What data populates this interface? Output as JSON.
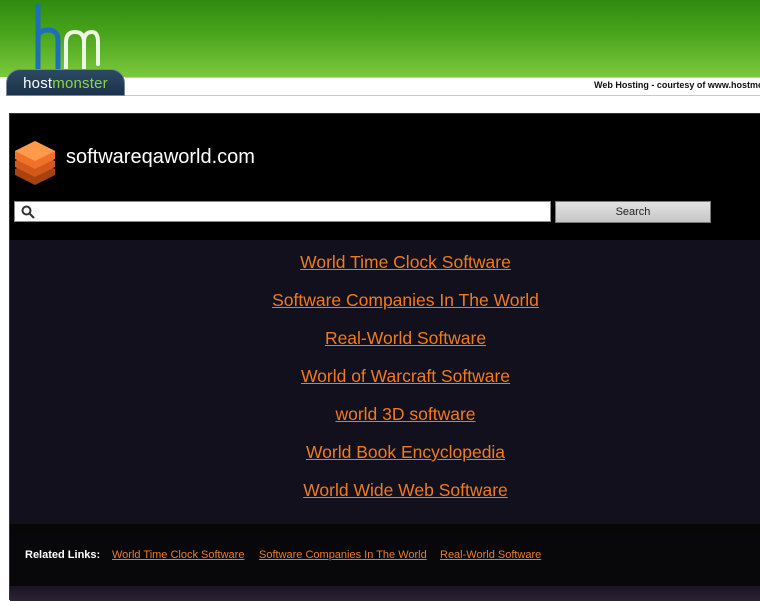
{
  "banner": {
    "logo_host": "host",
    "logo_monster": "monster",
    "credit_text": "Web Hosting - courtesy of www.hostmonster.com"
  },
  "site": {
    "title": "softwareqaworld.com"
  },
  "search": {
    "placeholder": "",
    "value": "",
    "button_label": "Search"
  },
  "links": [
    {
      "label": "World Time Clock Software"
    },
    {
      "label": "Software Companies In The World"
    },
    {
      "label": "Real-World Software"
    },
    {
      "label": "World of Warcraft Software"
    },
    {
      "label": "world 3D software"
    },
    {
      "label": "World Book Encyclopedia"
    },
    {
      "label": "World Wide Web Software"
    }
  ],
  "related": {
    "label": "Related Links:",
    "items": [
      {
        "label": "World Time Clock Software"
      },
      {
        "label": "Software Companies In The World"
      },
      {
        "label": "Real-World Software"
      }
    ]
  },
  "colors": {
    "link": "#f07a1f",
    "banner_green": "#4aa51c",
    "panel_bg": "#12101c"
  }
}
